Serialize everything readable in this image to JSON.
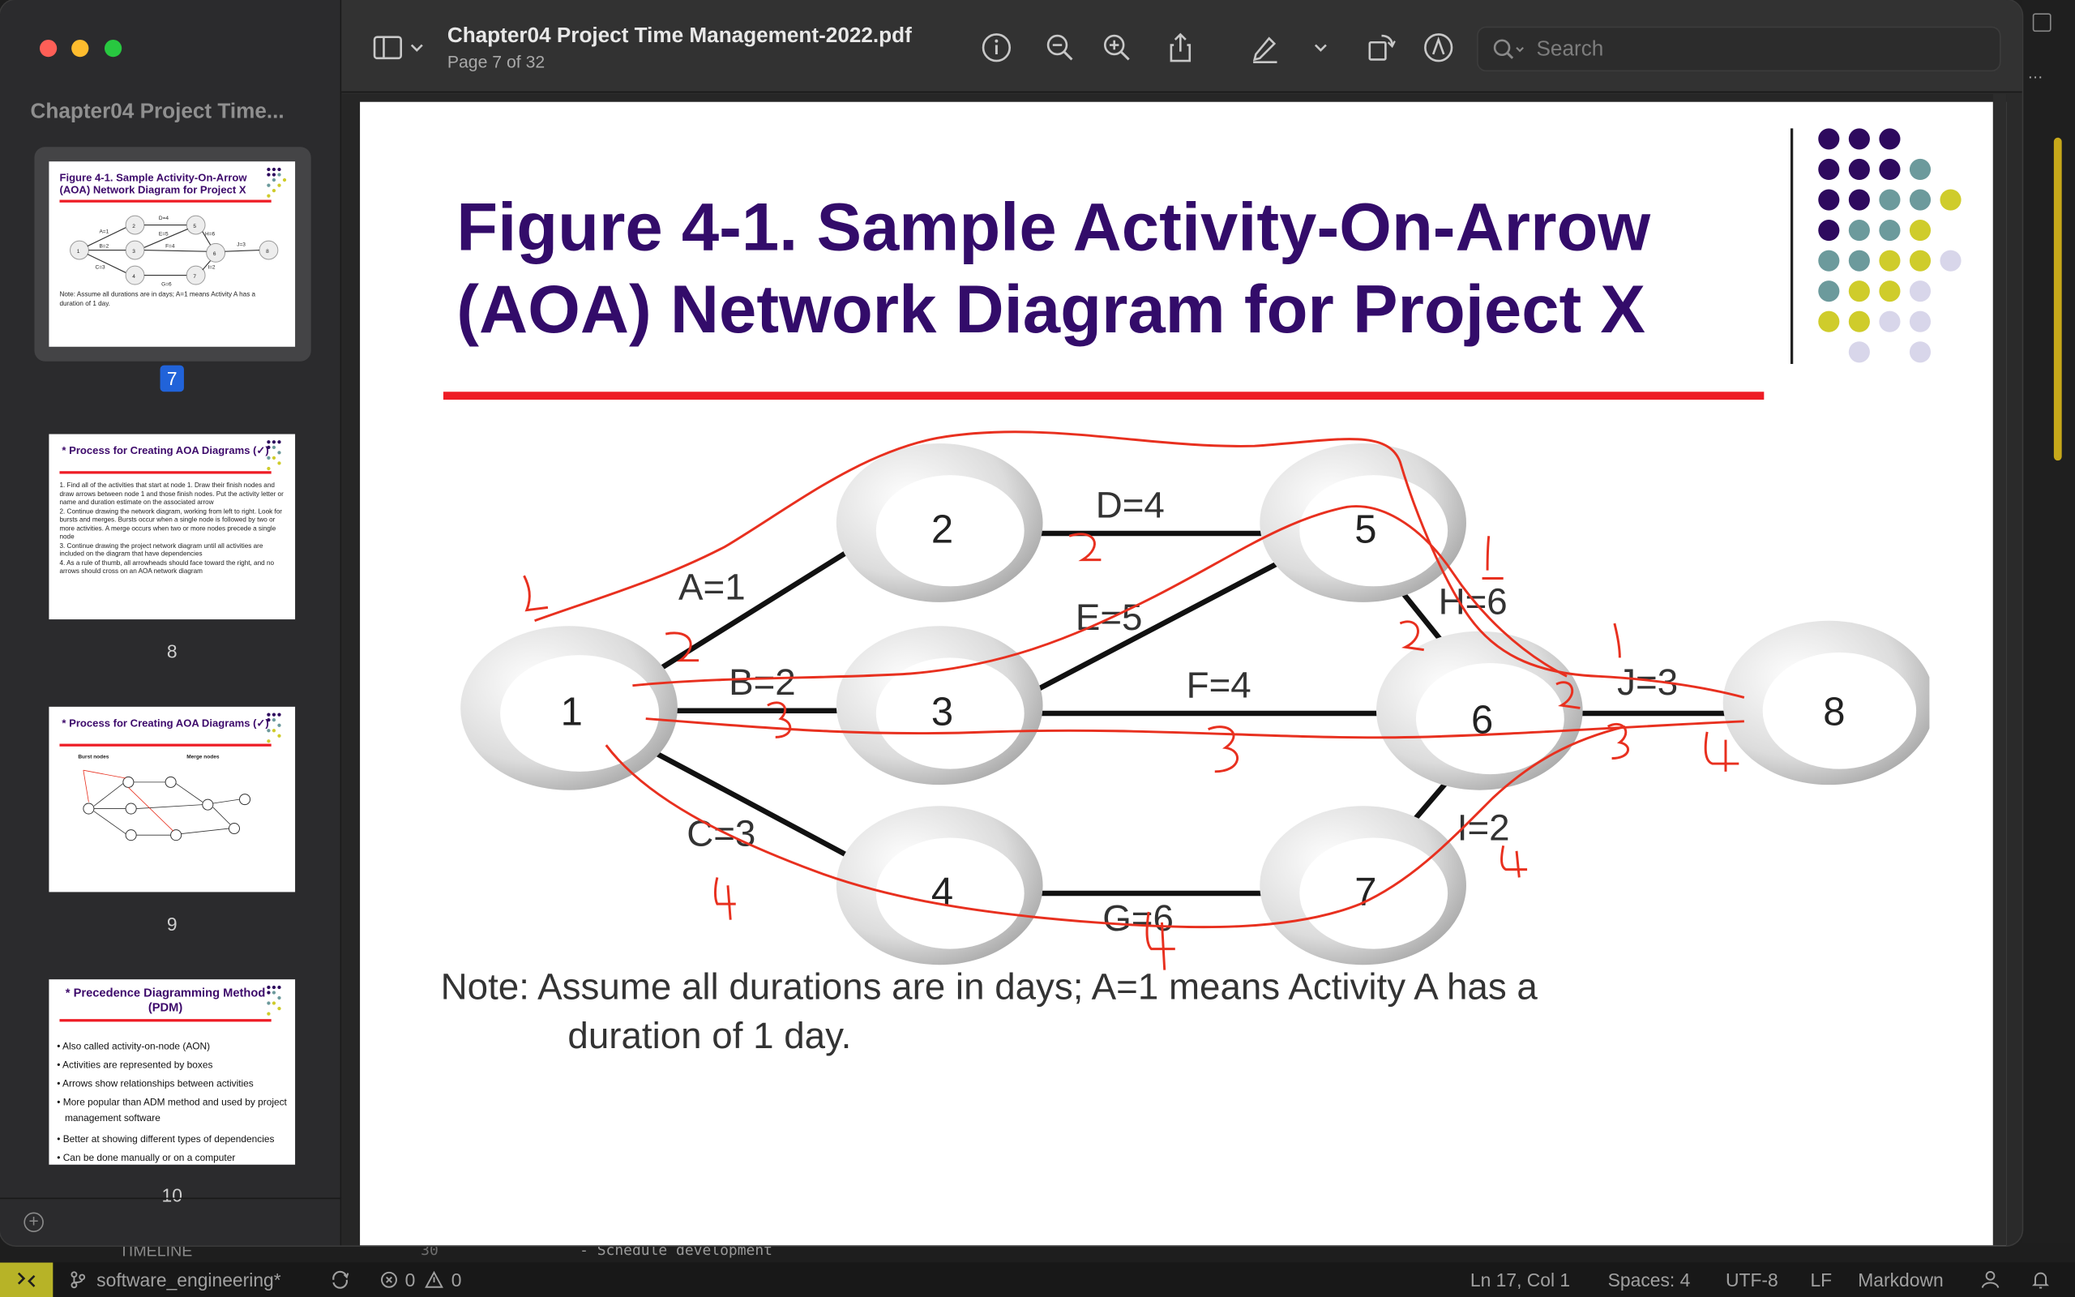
{
  "window": {
    "sidebar_title": "Chapter04 Project Time...",
    "doc_title": "Chapter04 Project Time Management-2022.pdf",
    "doc_subtitle": "Page 7 of 32",
    "search_placeholder": "Search"
  },
  "toolbar_icons": [
    "sidebar-toggle-icon",
    "chevron-down-icon",
    "info-icon",
    "zoom-out-icon",
    "zoom-in-icon",
    "share-icon",
    "highlight-pen-icon",
    "chevron-down-icon",
    "rotate-icon",
    "markup-icon",
    "search-icon"
  ],
  "thumbnails": [
    {
      "page": "7",
      "title": "Figure 4-1. Sample Activity-On-Arrow (AOA) Network Diagram for Project X",
      "note": "Note:  Assume all durations are in days;  A=1 means Activity A has a duration of 1 day.",
      "selected": true
    },
    {
      "page": "8",
      "title": "* Process for Creating AOA Diagrams (✓)",
      "lines": [
        "1. Find all of the activities that start at node 1.  Draw their finish nodes and draw arrows between node 1 and those finish nodes.  Put the activity letter or name and duration estimate on the associated arrow",
        "2. Continue drawing the network diagram, working from left to right. Look for bursts and merges.  Bursts occur when a single node is followed by two or more activities.  A merge occurs when two or more nodes precede a single node",
        "3. Continue drawing the project network diagram until all activities are included on the diagram that have dependencies",
        "4. As a rule of thumb, all arrowheads should face toward the right, and no arrows should cross on an AOA network diagram"
      ]
    },
    {
      "page": "9",
      "title": "* Process for Creating AOA Diagrams (✓)",
      "label_burst": "Burst nodes",
      "label_merge": "Merge nodes"
    },
    {
      "page": "10",
      "title": "* Precedence Diagramming Method (PDM)",
      "bullets": [
        "Also called activity-on-node (AON)",
        "Activities are represented by boxes",
        "Arrows show relationships between activities",
        "More popular than ADM method and used by project management software",
        "Better at showing different types of dependencies",
        "Can be done manually or on a computer"
      ]
    }
  ],
  "slide": {
    "title_line1": "Figure 4-1. Sample Activity-On-Arrow",
    "title_line2": "(AOA) Network Diagram for Project X",
    "note_line1": "Note:  Assume all durations are in days;  A=1 means Activity A has a",
    "note_line2": "duration of 1 day.",
    "nodes": [
      "1",
      "2",
      "3",
      "4",
      "5",
      "6",
      "7",
      "8"
    ],
    "activities": [
      "A=1",
      "B=2",
      "C=3",
      "D=4",
      "E=5",
      "F=4",
      "G=6",
      "H=6",
      "I=2",
      "J=3"
    ],
    "handwritten": [
      "1",
      "1",
      "1",
      "1",
      "2",
      "2",
      "2",
      "2",
      "3",
      "3",
      "3",
      "4",
      "4",
      "4",
      "4"
    ]
  },
  "background_editor": {
    "timeline_label": "TIMELINE",
    "line_number": "30",
    "code_text": "- Schedule development"
  },
  "statusbar": {
    "branch": "software_engineering*",
    "errors": "0",
    "warnings": "0",
    "position": "Ln 17, Col 1",
    "spaces": "Spaces: 4",
    "encoding": "UTF-8",
    "eol": "LF",
    "language": "Markdown"
  },
  "colors": {
    "title_purple": "#330c6a",
    "red_rule": "#ee1c25",
    "annotation_red": "#e8301f",
    "dot_purple": "#2e0a5e",
    "dot_teal": "#6c9a9c",
    "dot_yellow": "#cfcc2b",
    "dot_lavender": "#d8d6ea"
  }
}
